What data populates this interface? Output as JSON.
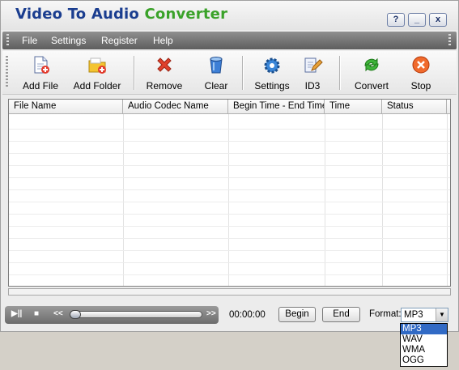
{
  "title": {
    "part1": "Video To Audio ",
    "part2": "Converter"
  },
  "window_buttons": {
    "help": "?",
    "minimize": "_",
    "close": "x"
  },
  "menu": {
    "items": [
      "File",
      "Settings",
      "Register",
      "Help"
    ]
  },
  "toolbar": {
    "add_file": "Add File",
    "add_folder": "Add Folder",
    "remove": "Remove",
    "clear": "Clear",
    "settings": "Settings",
    "id3": "ID3",
    "convert": "Convert",
    "stop": "Stop"
  },
  "table": {
    "columns": [
      "File Name",
      "Audio Codec Name",
      "Begin Time - End Time",
      "Time",
      "Status"
    ],
    "rows": []
  },
  "player": {
    "play": "▶||",
    "stop": "■",
    "rewind": "<<",
    "forward": ">>",
    "position": 0.0,
    "time": "00:00:00"
  },
  "buttons": {
    "begin": "Begin",
    "end": "End"
  },
  "format": {
    "label": "Format:",
    "selected": "MP3",
    "options": [
      "MP3",
      "WAV",
      "WMA",
      "OGG"
    ]
  },
  "colors": {
    "title_blue": "#1a3d8f",
    "title_green": "#3aa229",
    "selection": "#316ac5"
  }
}
